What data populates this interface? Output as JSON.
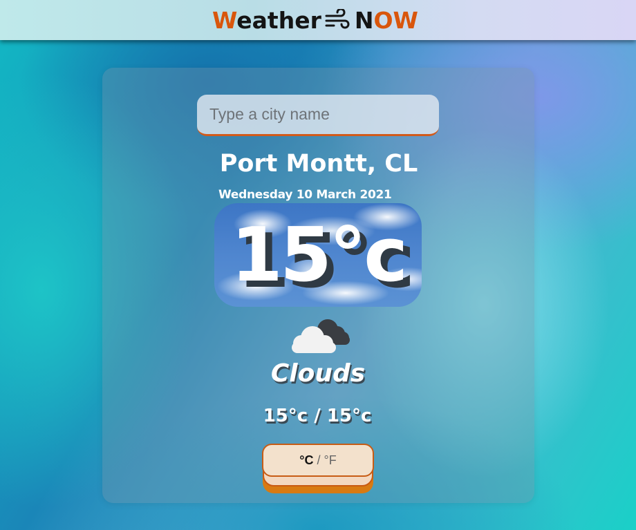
{
  "header": {
    "logo_w": "W",
    "logo_eather": "eather",
    "logo_n": "N",
    "logo_ow": "OW",
    "logo_icon": "wind-icon",
    "accent_color": "#d9560c"
  },
  "search": {
    "placeholder": "Type a city name",
    "value": ""
  },
  "weather": {
    "city": "Port Montt, CL",
    "date": "Wednesday 10 March 2021",
    "temperature": "15°c",
    "condition_icon": "clouds-icon",
    "condition": "Clouds",
    "range": "15°c / 15°c"
  },
  "units": {
    "active": "°C",
    "separator": "/",
    "inactive": "°F"
  }
}
